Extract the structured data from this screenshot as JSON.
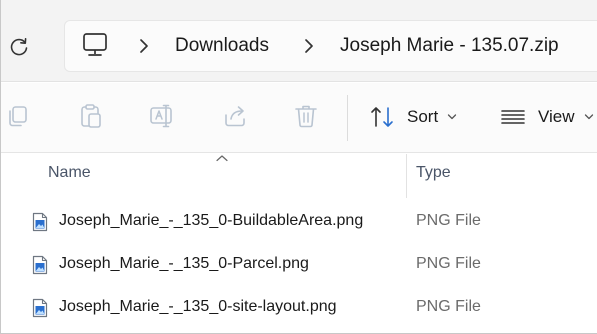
{
  "address_bar": {
    "breadcrumbs": [
      "Downloads",
      "Joseph Marie - 135.07.zip"
    ]
  },
  "toolbar": {
    "sort_label": "Sort",
    "view_label": "View"
  },
  "columns": {
    "name": "Name",
    "type": "Type"
  },
  "files": [
    {
      "name": "Joseph_Marie_-_135_0-BuildableArea.png",
      "type": "PNG File"
    },
    {
      "name": "Joseph_Marie_-_135_0-Parcel.png",
      "type": "PNG File"
    },
    {
      "name": "Joseph_Marie_-_135_0-site-layout.png",
      "type": "PNG File"
    }
  ],
  "colors": {
    "accent": "#2a6fce",
    "toolbar_disabled_icon": "#b9c4d1",
    "secondary_text": "#6b6b6b"
  }
}
